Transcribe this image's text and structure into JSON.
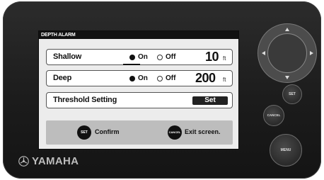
{
  "screen": {
    "title": "DEPTH ALARM",
    "rows": [
      {
        "label": "Shallow",
        "on_label": "On",
        "off_label": "Off",
        "selected": "On",
        "value": "10",
        "unit": "ft"
      },
      {
        "label": "Deep",
        "on_label": "On",
        "off_label": "Off",
        "selected": "On",
        "value": "200",
        "unit": "ft"
      }
    ],
    "threshold": {
      "label": "Threshold Setting",
      "button_label": "Set"
    },
    "footer": {
      "set_badge": "SET",
      "set_text": "Confirm",
      "cancel_badge": "CANCEL",
      "cancel_text": "Exit screen."
    }
  },
  "device": {
    "brand": "YAMAHA",
    "buttons": {
      "set": "SET",
      "cancel": "CANCEL",
      "menu": "MENU"
    }
  }
}
